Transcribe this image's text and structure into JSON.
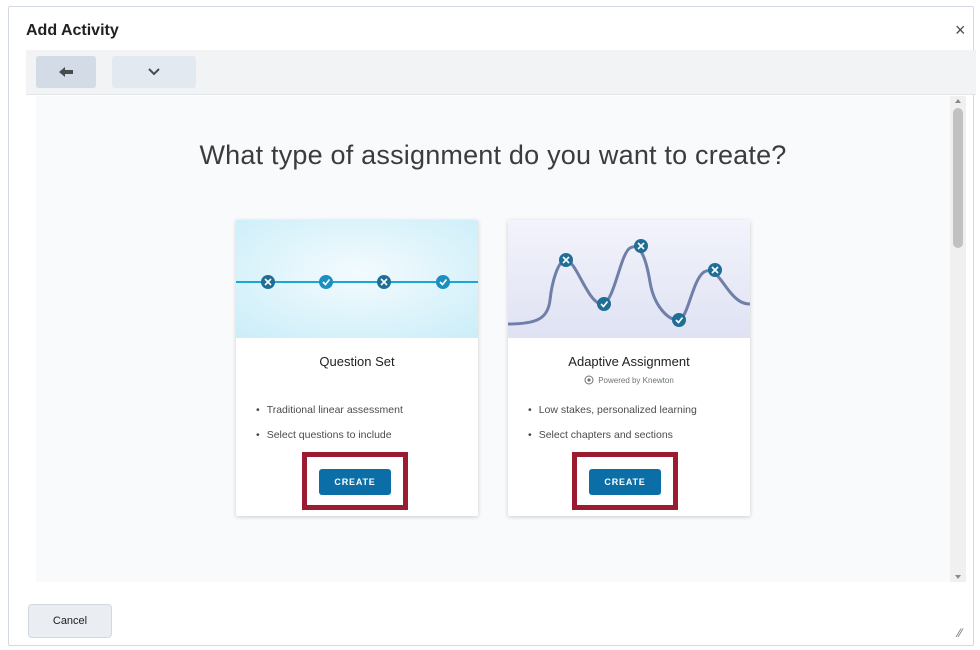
{
  "dialog": {
    "title": "Add Activity",
    "close_glyph": "×"
  },
  "toolbar": {
    "back_icon": "arrow-left-icon",
    "more_icon": "chevron-down-icon"
  },
  "main": {
    "question": "What type of assignment do you want to create?",
    "cards": [
      {
        "title": "Question Set",
        "bullets": [
          "Traditional linear assessment",
          "Select questions to include"
        ],
        "button_label": "CREATE"
      },
      {
        "title": "Adaptive Assignment",
        "powered_by": "Powered by Knewton",
        "bullets": [
          "Low stakes, personalized learning",
          "Select chapters and sections"
        ],
        "button_label": "CREATE"
      }
    ]
  },
  "footer": {
    "cancel_label": "Cancel"
  },
  "colors": {
    "accent": "#0b6ea6",
    "highlight": "#9b1b30",
    "node": "#1f6e96",
    "path": "#6f7fa8"
  }
}
